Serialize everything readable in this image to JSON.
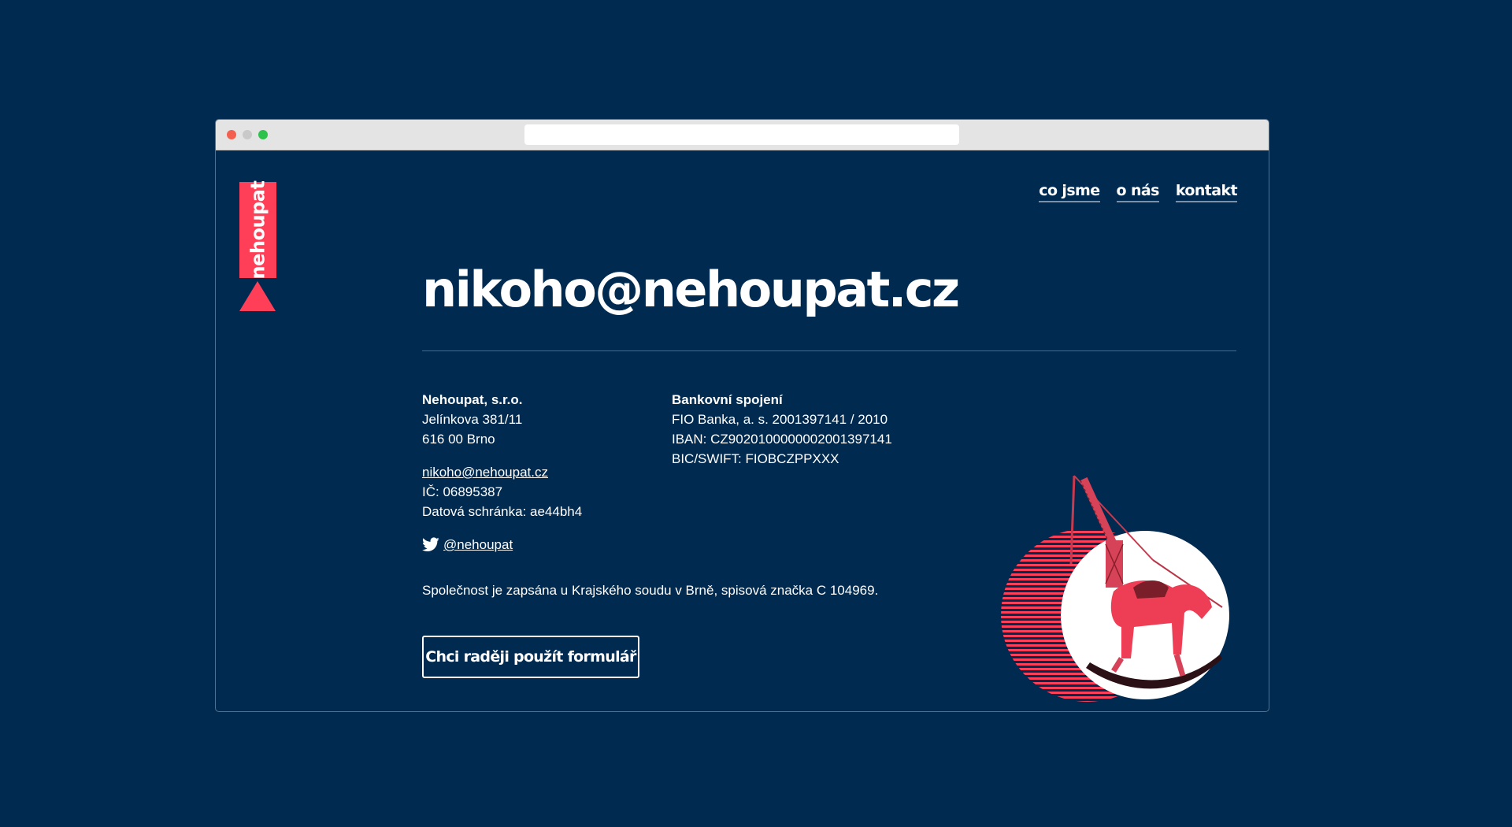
{
  "browser": {
    "address": ""
  },
  "logo": {
    "text": "nehoupat"
  },
  "nav": {
    "items": [
      {
        "label": "co jsme"
      },
      {
        "label": "o nás"
      },
      {
        "label": "kontakt"
      }
    ]
  },
  "headline": "nikoho@nehoupat.cz",
  "company": {
    "name": "Nehoupat, s.r.o.",
    "street": "Jelínkova 381/11",
    "city": "616 00 Brno",
    "email": "nikoho@nehoupat.cz",
    "ic": "IČ: 06895387",
    "datova_schranka": "Datová schránka: ae44bh4",
    "twitter": "@nehoupat"
  },
  "bank": {
    "title": "Bankovní spojení",
    "account": "FIO Banka, a. s. 2001397141 / 2010",
    "iban": "IBAN: CZ9020100000002001397141",
    "bic": "BIC/SWIFT: FIOBCZPPXXX"
  },
  "registration": "Společnost je zapsána u Krajského soudu v Brně, spisová značka C 104969.",
  "form_button": "Chci raději použít formulář",
  "colors": {
    "background": "#002a4f",
    "accent": "#ff3e57",
    "text": "#ffffff"
  },
  "icons": {
    "twitter": "twitter-bird-icon",
    "illustration": "rocking-horse-crane-illustration"
  }
}
